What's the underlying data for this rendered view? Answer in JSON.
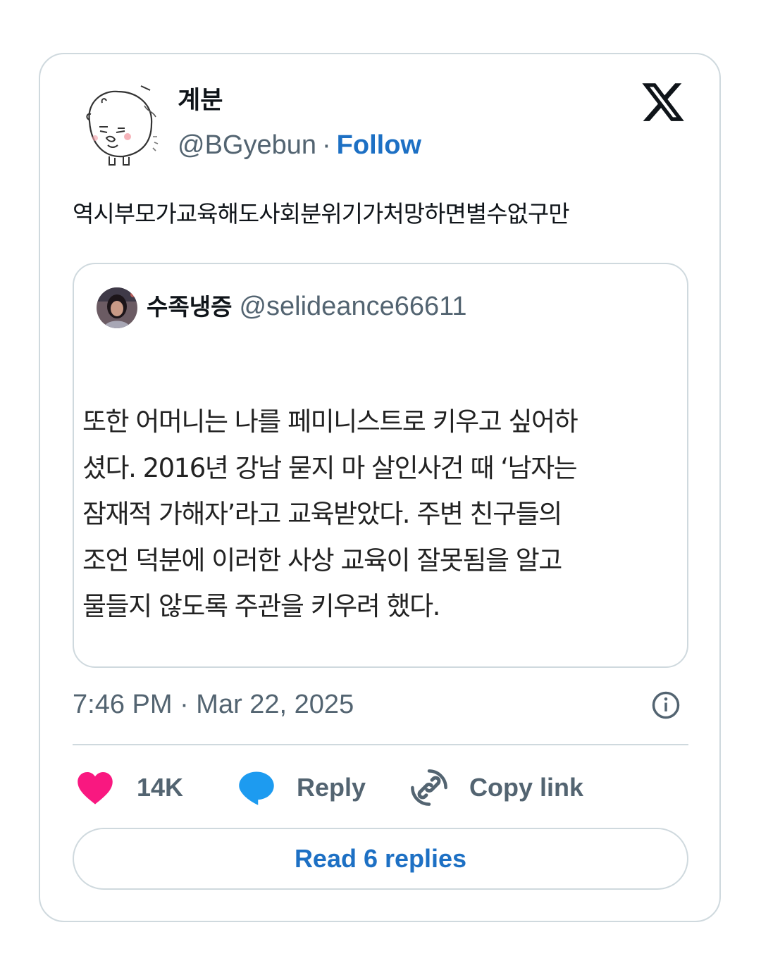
{
  "tweet": {
    "author": {
      "display_name": "계분",
      "handle": "@BGyebun",
      "separator": "·",
      "follow_label": "Follow",
      "avatar_icon": "cartoon-face-avatar"
    },
    "platform_logo": "x-logo-icon",
    "text": "역시부모가교육해도사회분위기가처망하면별수없구만",
    "quoted": {
      "display_name": "수족냉증",
      "handle": "@selideance66611",
      "body_lines": [
        "또한 어머니는 나를 페미니스트로 키우고 싶어하",
        "셨다. 2016년 강남 묻지 마 살인사건 때 ‘남자는",
        "잠재적 가해자’라고 교육받았다. 주변 친구들의",
        "조언 덕분에 이러한 사상 교육이 잘못됨을 알고",
        "물들지 않도록 주관을 키우려 했다."
      ]
    },
    "timestamp": "7:46 PM · Mar 22, 2025",
    "actions": {
      "like_count": "14K",
      "reply_label": "Reply",
      "copy_label": "Copy link"
    },
    "read_replies_label": "Read 6 replies"
  },
  "colors": {
    "accent": "#1d70c4",
    "secondary_text": "#536471",
    "border": "#cfd9de",
    "heart": "#f91880",
    "reply_bubble": "#1d9bf0"
  }
}
